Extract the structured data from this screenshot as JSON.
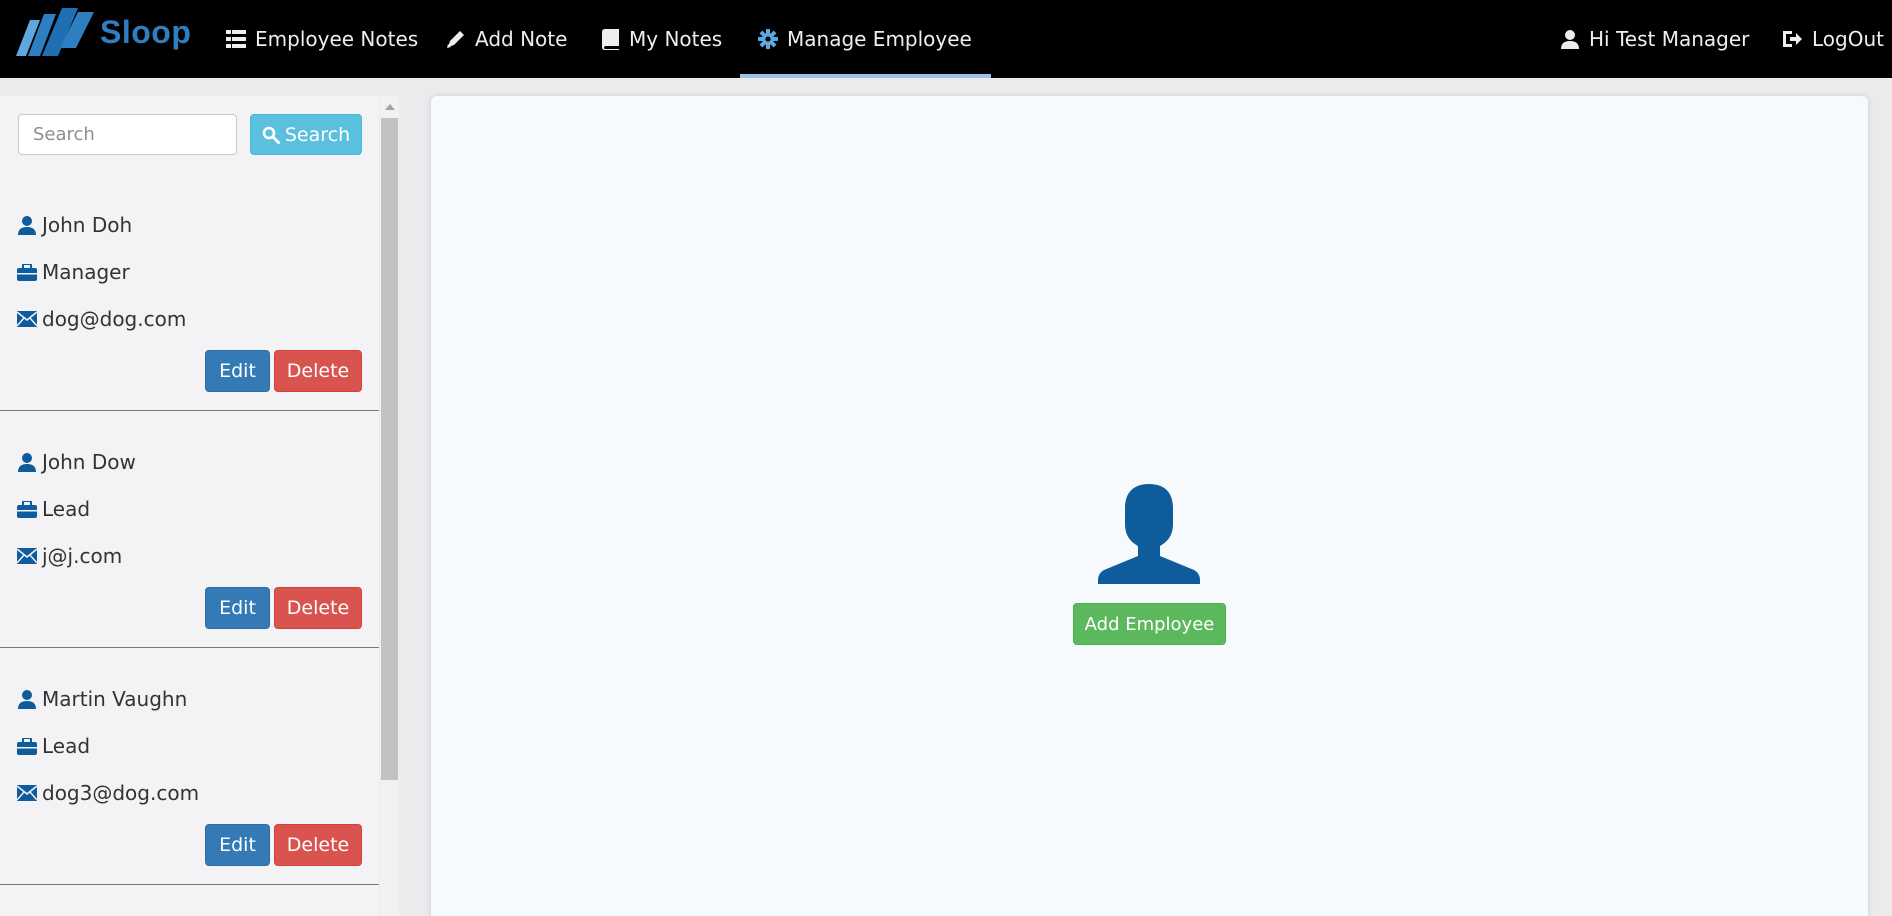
{
  "brand": {
    "name": "Sloop",
    "accent": "#2e7fc1"
  },
  "nav": {
    "items": [
      {
        "label": "Employee Notes",
        "icon": "list-icon"
      },
      {
        "label": "Add Note",
        "icon": "pencil-icon"
      },
      {
        "label": "My Notes",
        "icon": "book-icon"
      },
      {
        "label": "Manage Employee",
        "icon": "gear-icon",
        "active": true
      }
    ],
    "greeting": "Hi Test Manager",
    "logout": "LogOut"
  },
  "sidebar": {
    "search": {
      "placeholder": "Search",
      "value": "",
      "button_label": "Search"
    },
    "employees": [
      {
        "name": "John Doh",
        "role": "Manager",
        "email": "dog@dog.com",
        "edit_label": "Edit",
        "delete_label": "Delete"
      },
      {
        "name": "John Dow",
        "role": "Lead",
        "email": "j@j.com",
        "edit_label": "Edit",
        "delete_label": "Delete"
      },
      {
        "name": "Martin Vaughn",
        "role": "Lead",
        "email": "dog3@dog.com",
        "edit_label": "Edit",
        "delete_label": "Delete"
      }
    ]
  },
  "main": {
    "placeholder_icon": "user-silhouette-icon",
    "add_button_label": "Add Employee"
  },
  "colors": {
    "primary": "#337ab7",
    "danger": "#d9534f",
    "info": "#5bc0de",
    "success": "#5cb85c",
    "icon_blue": "#0e5c9c"
  }
}
